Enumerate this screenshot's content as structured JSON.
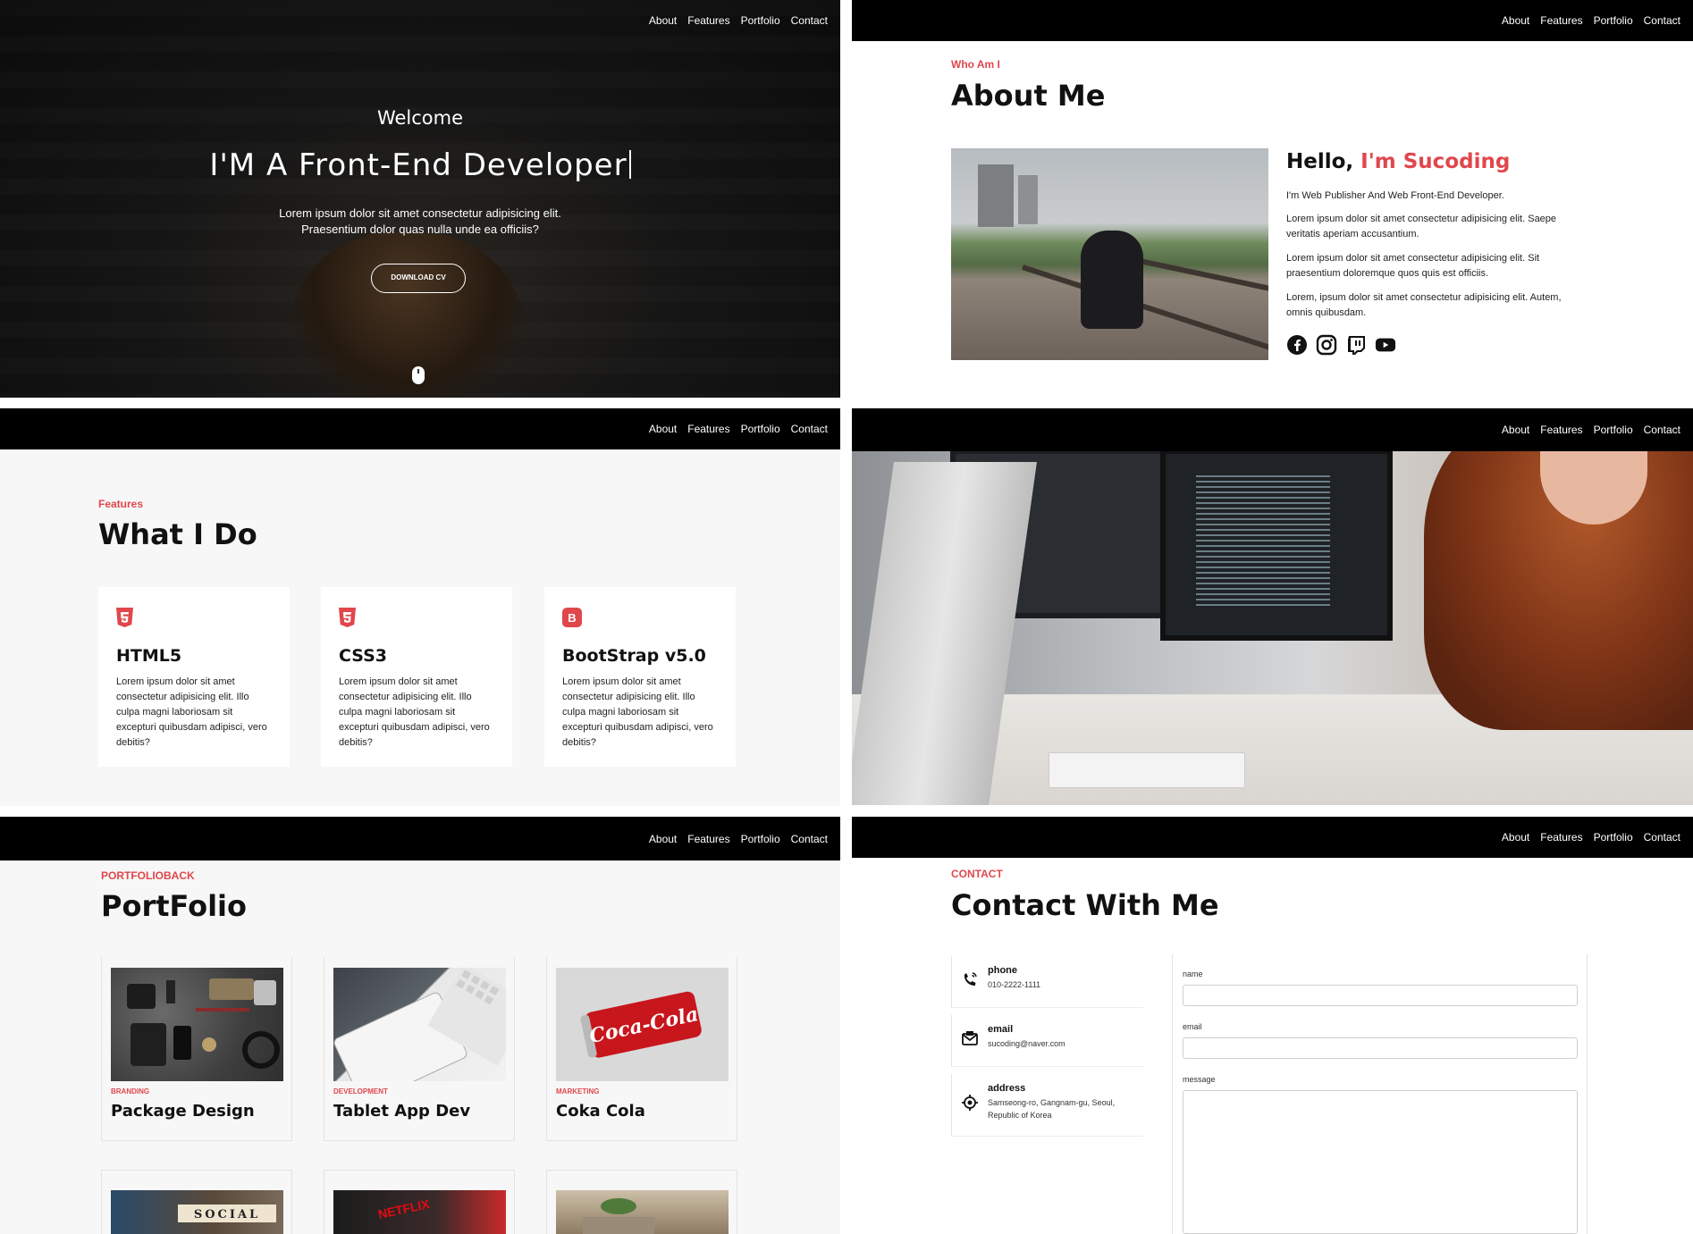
{
  "nav": [
    "About",
    "Features",
    "Portfolio",
    "Contact"
  ],
  "hero": {
    "welcome": "Welcome",
    "title": "I'M A Front-End Developer",
    "desc": "Lorem ipsum dolor sit amet consectetur adipisicing elit. Praesentium dolor quas nulla unde ea officiis?",
    "button": "DOWNLOAD CV"
  },
  "about": {
    "eyebrow": "Who Am I",
    "title": "About Me",
    "hello": "Hello,",
    "name": "I'm Sucoding",
    "p1": "I'm Web Publisher And Web Front-End Developer.",
    "p2": "Lorem ipsum dolor sit amet consectetur adipisicing elit. Saepe veritatis aperiam accusantium.",
    "p3": "Lorem ipsum dolor sit amet consectetur adipisicing elit. Sit praesentium doloremque quos quis est officiis.",
    "p4": "Lorem, ipsum dolor sit amet consectetur adipisicing elit. Autem, omnis quibusdam.",
    "social": [
      "facebook-icon",
      "instagram-icon",
      "twitch-icon",
      "youtube-icon"
    ]
  },
  "features": {
    "eyebrow": "Features",
    "title": "What I Do",
    "cards": [
      {
        "title": "HTML5",
        "icon": "html5-icon",
        "text": "Lorem ipsum dolor sit amet consectetur adipisicing elit. Illo culpa magni laboriosam sit excepturi quibusdam adipisci, vero debitis?"
      },
      {
        "title": "CSS3",
        "icon": "css3-icon",
        "text": "Lorem ipsum dolor sit amet consectetur adipisicing elit. Illo culpa magni laboriosam sit excepturi quibusdam adipisci, vero debitis?"
      },
      {
        "title": "BootStrap v5.0",
        "icon": "bootstrap-icon",
        "text": "Lorem ipsum dolor sit amet consectetur adipisicing elit. Illo culpa magni laboriosam sit excepturi quibusdam adipisci, vero debitis?"
      }
    ]
  },
  "portfolio": {
    "eyebrow": "PORTFOLIOBACK",
    "title": "PortFolio",
    "items": [
      {
        "category": "BRANDING",
        "title": "Package Design"
      },
      {
        "category": "DEVELOPMENT",
        "title": "Tablet App Dev"
      },
      {
        "category": "MARKETING",
        "title": "Coka Cola"
      }
    ],
    "thumb_texts": [
      "Coca-Cola",
      "SOCIAL",
      "NETFLIX"
    ]
  },
  "contact": {
    "eyebrow": "CONTACT",
    "title": "Contact With Me",
    "info": [
      {
        "label": "phone",
        "value": "010-2222-1111",
        "icon": "phone-icon"
      },
      {
        "label": "email",
        "value": "sucoding@naver.com",
        "icon": "mail-icon"
      },
      {
        "label": "address",
        "value": "Samseong-ro, Gangnam-gu, Seoul, Republic of Korea",
        "icon": "location-icon"
      }
    ],
    "form": {
      "name_label": "name",
      "email_label": "email",
      "message_label": "message"
    }
  },
  "colors": {
    "accent": "#e0474c",
    "nav_bg": "#000000",
    "section_bg": "#f7f7f7"
  }
}
